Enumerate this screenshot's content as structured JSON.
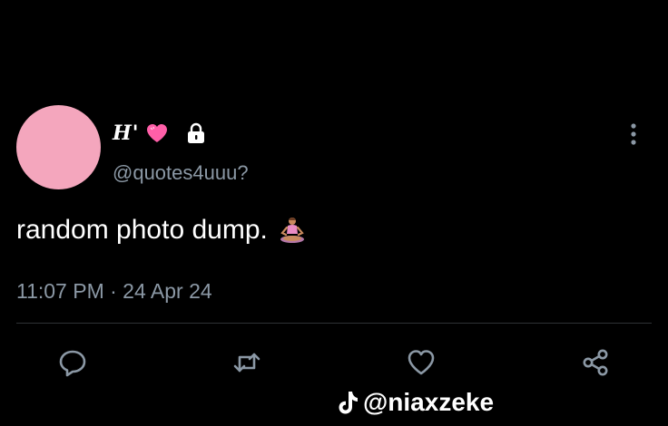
{
  "tweet": {
    "display_name": "H'",
    "handle": "@quotes4uuu?",
    "text": "random photo dump.",
    "timestamp": "11:07 PM · 24 Apr 24",
    "avatar_color": "#f4a6bd",
    "icons": {
      "name_emoji": "pink-heart-icon",
      "account_status": "lock-icon",
      "text_emoji": "meditating-person-icon",
      "menu": "more-vertical-icon"
    }
  },
  "actions": [
    {
      "name": "reply-button",
      "icon": "reply-icon"
    },
    {
      "name": "retweet-button",
      "icon": "retweet-icon"
    },
    {
      "name": "like-button",
      "icon": "heart-icon"
    },
    {
      "name": "share-button",
      "icon": "share-icon"
    }
  ],
  "watermark": {
    "text": "@niaxzeke",
    "icon": "tiktok-icon"
  },
  "colors": {
    "background": "#000000",
    "primary_text": "#ffffff",
    "secondary_text": "#8b98a5",
    "divider": "#2f3336",
    "icon": "#8b98a5"
  }
}
